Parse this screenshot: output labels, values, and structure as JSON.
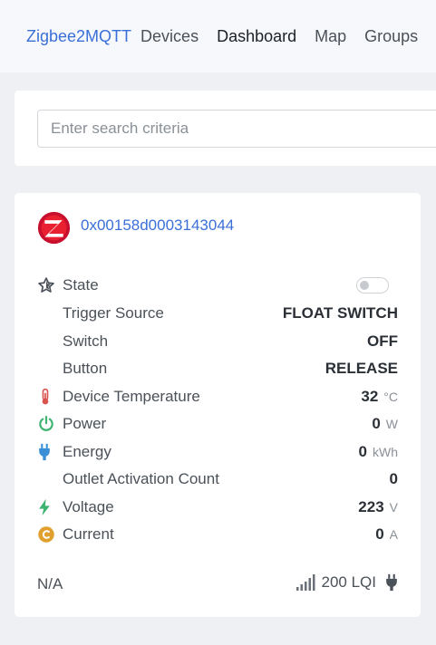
{
  "nav": {
    "brand": "Zigbee2MQTT",
    "items": [
      {
        "label": "Devices",
        "active": false
      },
      {
        "label": "Dashboard",
        "active": true
      },
      {
        "label": "Map",
        "active": false
      },
      {
        "label": "Groups",
        "active": false
      }
    ]
  },
  "search": {
    "placeholder": "Enter search criteria",
    "value": ""
  },
  "device": {
    "ieee_address": "0x00158d0003143044",
    "logo_icon": "zigbee-logo",
    "properties": [
      {
        "icon": "star-icon",
        "label": "State",
        "type": "toggle",
        "checked": false
      },
      {
        "icon": "",
        "label": "Trigger Source",
        "value": "FLOAT SWITCH",
        "unit": ""
      },
      {
        "icon": "",
        "label": "Switch",
        "value": "OFF",
        "unit": ""
      },
      {
        "icon": "",
        "label": "Button",
        "value": "RELEASE",
        "unit": ""
      },
      {
        "icon": "thermometer-icon",
        "label": "Device Temperature",
        "value": "32",
        "unit": "°C"
      },
      {
        "icon": "power-icon",
        "label": "Power",
        "value": "0",
        "unit": "W"
      },
      {
        "icon": "plug-icon",
        "label": "Energy",
        "value": "0",
        "unit": "kWh"
      },
      {
        "icon": "",
        "label": "Outlet Activation Count",
        "value": "0",
        "unit": ""
      },
      {
        "icon": "bolt-icon",
        "label": "Voltage",
        "value": "223",
        "unit": "V"
      },
      {
        "icon": "current-icon",
        "label": "Current",
        "value": "0",
        "unit": "A"
      }
    ],
    "footer": {
      "last_seen": "N/A",
      "lqi": "200 LQI",
      "signal_icon": "signal-icon",
      "power_source_icon": "plug-icon"
    }
  },
  "colors": {
    "brand": "#3b6fd8",
    "thermometer": "#d9534f",
    "power": "#3cb371",
    "plug": "#3a8fd6",
    "bolt": "#3cb371",
    "current": "#e0a030"
  }
}
